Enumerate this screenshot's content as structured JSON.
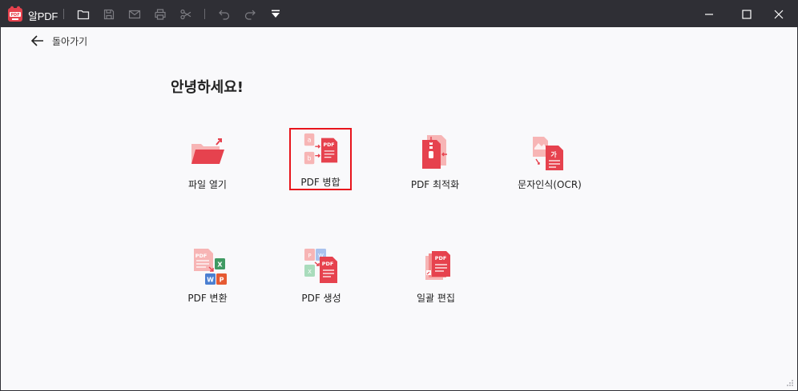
{
  "app": {
    "name": "알PDF"
  },
  "nav": {
    "back_label": "돌아가기"
  },
  "main": {
    "greeting": "안녕하세요!",
    "tools": [
      {
        "label": "파일 열기",
        "icon": "open-folder-icon"
      },
      {
        "label": "PDF 병합",
        "icon": "merge-pdf-icon",
        "selected": true
      },
      {
        "label": "PDF 최적화",
        "icon": "compress-pdf-icon"
      },
      {
        "label": "문자인식(OCR)",
        "icon": "ocr-icon"
      },
      {
        "label": "PDF 변환",
        "icon": "convert-pdf-icon"
      },
      {
        "label": "PDF 생성",
        "icon": "create-pdf-icon"
      },
      {
        "label": "일괄 편집",
        "icon": "batch-edit-icon"
      }
    ]
  },
  "colors": {
    "titlebar": "#2f2f35",
    "accent": "#e6424e",
    "accent_light": "#f7b5b5",
    "selection": "#e8141c",
    "background": "#f9f9fb"
  }
}
